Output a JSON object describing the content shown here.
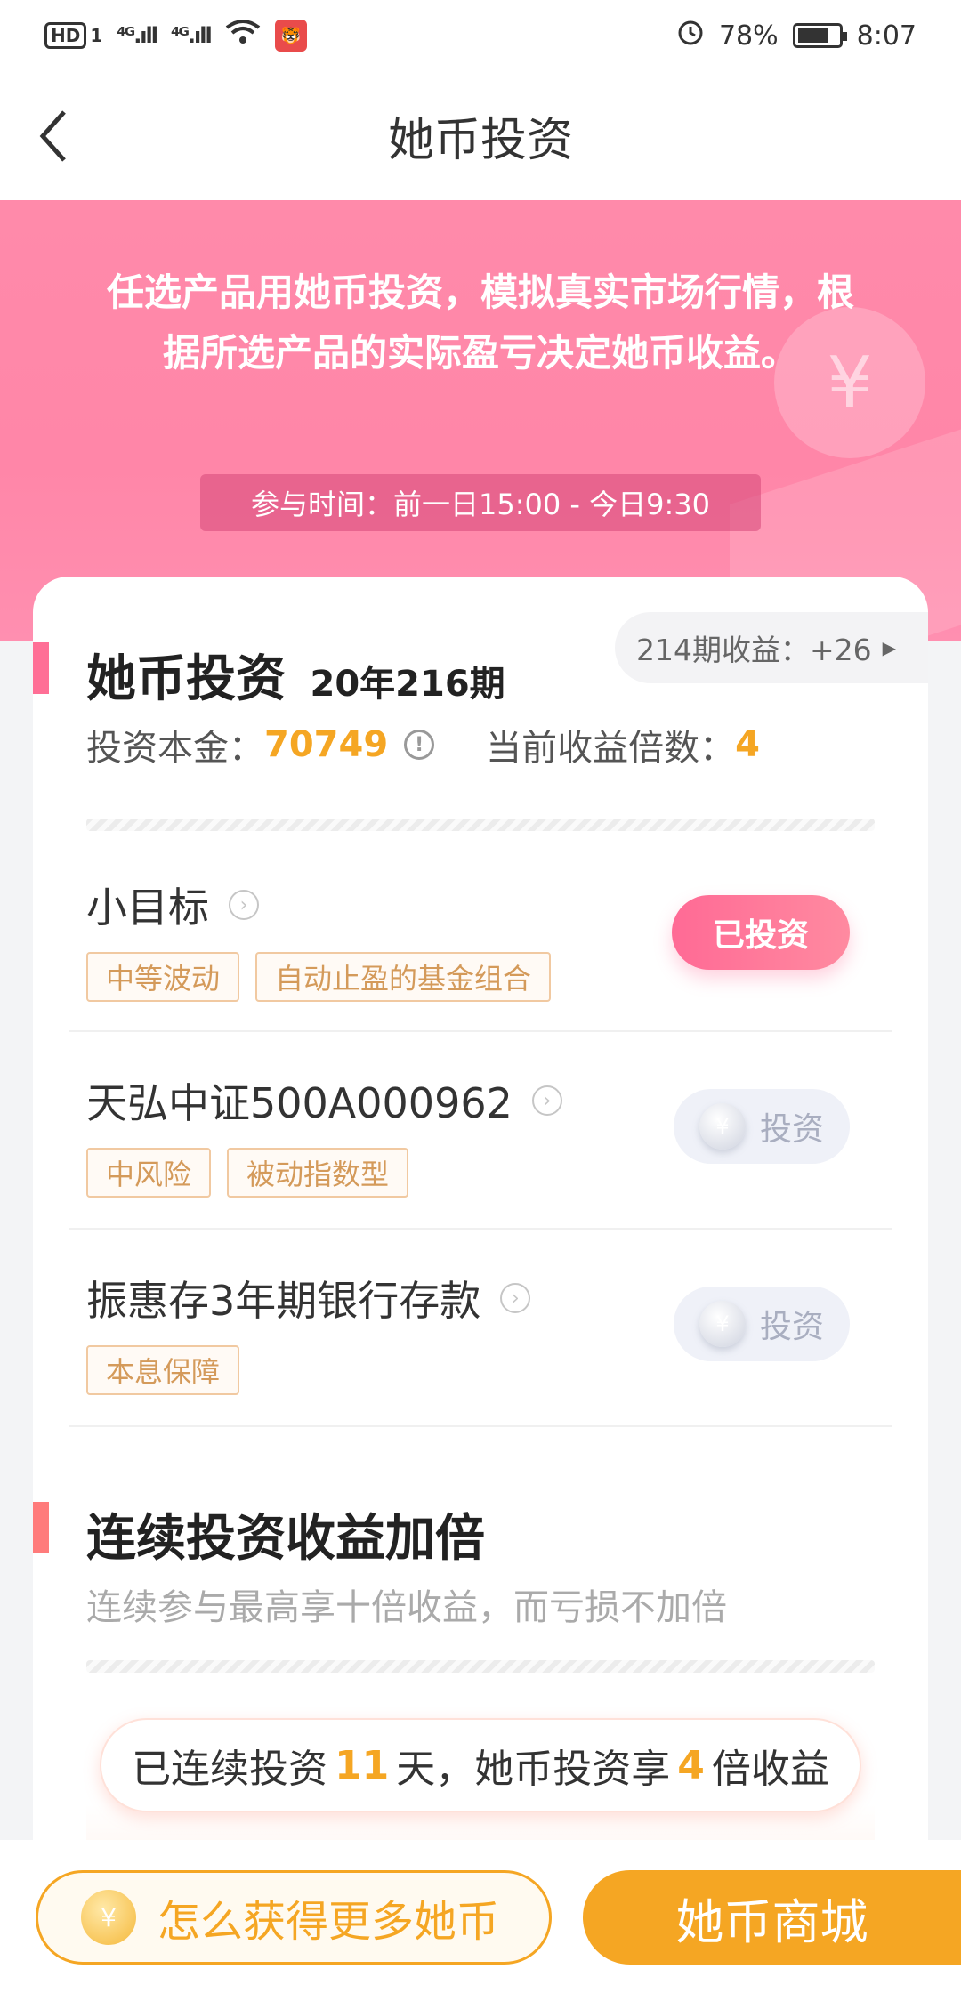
{
  "status_bar": {
    "hd": "HD",
    "sim": "1",
    "signal1": "⁴ᴳ.ıll",
    "signal2": "⁴ᴳ.ıll",
    "battery": "78%",
    "time": "8:07"
  },
  "nav": {
    "back_icon": "chevron-left-icon",
    "title": "她币投资"
  },
  "hero": {
    "text": "任选产品用她币投资，模拟真实市场行情，根据所选产品的实际盈亏决定她币收益。",
    "time": "参与时间：前一日15:00 - 今日9:30",
    "deco_symbol": "¥"
  },
  "investment": {
    "title": "她币投资",
    "period": "20年216期",
    "prev_period_badge": "214期收益：+26",
    "principal_label": "投资本金：",
    "principal_value": "70749",
    "multiplier_label": "当前收益倍数：",
    "multiplier_value": "4"
  },
  "products": [
    {
      "name": "小目标",
      "tags": [
        "中等波动",
        "自动止盈的基金组合"
      ],
      "button": "已投资",
      "state": "invested"
    },
    {
      "name": "天弘中证500A000962",
      "tags": [
        "中风险",
        "被动指数型"
      ],
      "button": "投资",
      "state": "available"
    },
    {
      "name": "振惠存3年期银行存款",
      "tags": [
        "本息保障"
      ],
      "button": "投资",
      "state": "available"
    }
  ],
  "streak": {
    "title": "连续投资收益加倍",
    "subtitle": "连续参与最高享十倍收益，而亏损不加倍",
    "text_before": "已连续投资",
    "days": "11",
    "text_middle": "天，她币投资享",
    "multiplier": "4",
    "text_after": "倍收益"
  },
  "bottom": {
    "more_coins": "怎么获得更多她币",
    "mall": "她币商城"
  },
  "colors": {
    "pink": "#ff86a8",
    "orange": "#f5a623",
    "accent": "#ff6f96"
  }
}
